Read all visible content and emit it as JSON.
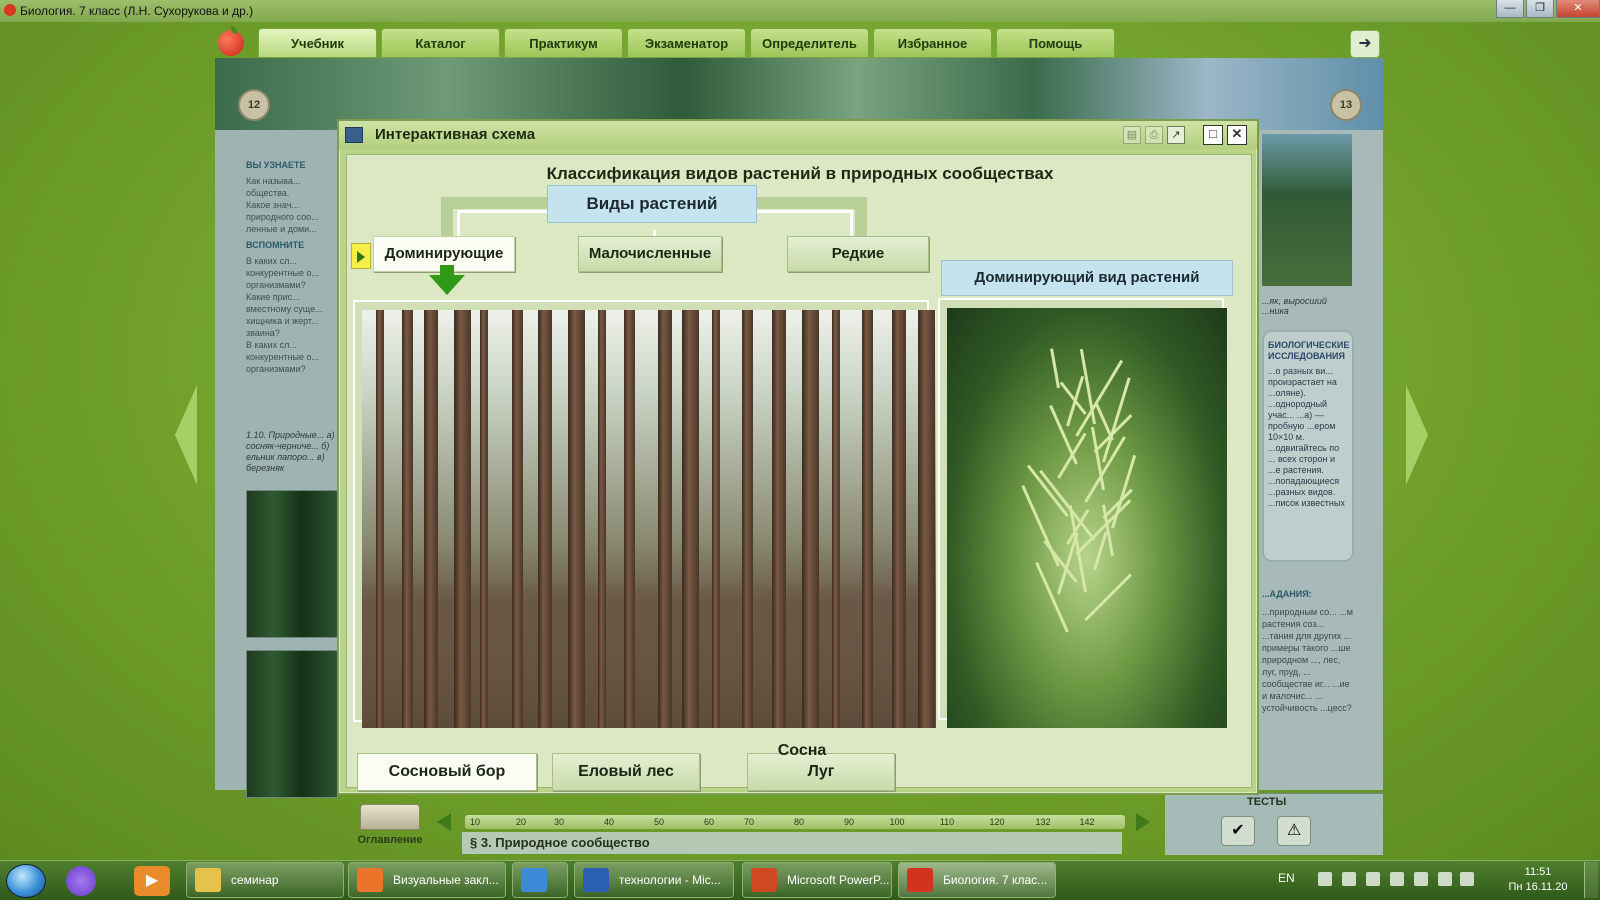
{
  "window": {
    "title": "Биология. 7 класс (Л.Н. Сухорукова и др.)",
    "buttons": [
      "—",
      "❐",
      "✕"
    ]
  },
  "nav": {
    "tabs": [
      {
        "label": "Учебник",
        "active": true
      },
      {
        "label": "Каталог"
      },
      {
        "label": "Практикум"
      },
      {
        "label": "Экзаменатор"
      },
      {
        "label": "Определитель"
      },
      {
        "label": "Избранное"
      },
      {
        "label": "Помощь"
      }
    ],
    "exit_icon": "exit-arrow-icon"
  },
  "book": {
    "page_left": "12",
    "page_right": "13",
    "left": {
      "heading1": "ВЫ УЗНАЕТЕ",
      "items1": [
        "Как называ... общества.",
        "Какое знач... природного соо... ленные и доми..."
      ],
      "heading2": "ВСПОМНИТЕ",
      "items2": [
        "В каких сл... конкурентные о... организмами?",
        "Какие прис... вместному суще... хищника и жерт... зваина?",
        "В каких сл... конкурентные о... организмами?"
      ],
      "caption": "1.10. Природные... а) сосняк-черниче... б) ельник папоро... в) березняк"
    },
    "right": {
      "caption": "...як, выросший ...ника",
      "note_title": "БИОЛОГИЧЕСКИЕ ИССЛЕДОВАНИЯ",
      "note_text": "...о разных ви... произрастает на ...оляне). ...однородный учас... ...а) — пробную ...ером 10×10 м. ...одвигайтесь по ... всех сторон и ...е растения. ...попадающиеся ...разных видов. ...писок известных",
      "tasks_title": "...АДАНИЯ:",
      "tasks_text": "...природным со... ...м растения соз... ...тания для других ... примеры такого ...ше природном ..., лес, луг, пруд, ... сообществе иг... ...ие и малочис... ... устойчивость ...цесс?"
    }
  },
  "modal": {
    "title": "Интерактивная схема",
    "heading": "Классификация видов растений в природных сообществах",
    "root": "Виды растений",
    "categories": [
      {
        "label": "Доминирующие",
        "active": true
      },
      {
        "label": "Малочисленные"
      },
      {
        "label": "Редкие"
      }
    ],
    "right_header": "Доминирующий вид растений",
    "communities": [
      {
        "label": "Сосновый бор",
        "active": true
      },
      {
        "label": "Еловый лес"
      },
      {
        "label": "Луг"
      }
    ],
    "species": "Сосна"
  },
  "bottom": {
    "toc_label": "Оглавление",
    "timeline_ticks": [
      "10",
      "20",
      "30",
      "40",
      "50",
      "60",
      "70",
      "80",
      "90",
      "100",
      "110",
      "120",
      "132",
      "142"
    ],
    "section": "§ 3. Природное сообщество",
    "tests_label": "ТЕСТЫ"
  },
  "taskbar": {
    "items": [
      {
        "label": "семинар",
        "icon": "folder-icon",
        "color": "#e6c24a"
      },
      {
        "label": "Визуальные закл...",
        "icon": "firefox-icon",
        "color": "#e8752a"
      },
      {
        "label": "",
        "icon": "chrome-icon",
        "color": "#3c8ad8"
      },
      {
        "label": "технологии - Mic...",
        "icon": "word-icon",
        "color": "#2b5fb0"
      },
      {
        "label": "Microsoft PowerP...",
        "icon": "powerpoint-icon",
        "color": "#cf4a22"
      },
      {
        "label": "Биология. 7 клас...",
        "icon": "apple-icon",
        "color": "#d3321e",
        "active": true
      }
    ],
    "lang": "EN",
    "time": "11:51",
    "date": "Пн 16.11.20"
  }
}
